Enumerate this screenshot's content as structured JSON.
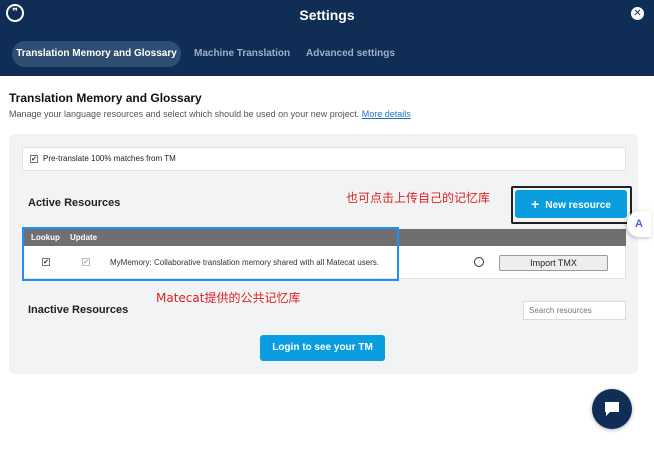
{
  "header": {
    "title": "Settings",
    "logo_glyph": "❞",
    "close_glyph": "✕",
    "tabs": [
      {
        "label": "Translation Memory and Glossary",
        "active": true
      },
      {
        "label": "Machine Translation",
        "active": false
      },
      {
        "label": "Advanced settings",
        "active": false
      }
    ]
  },
  "section": {
    "title": "Translation Memory and Glossary",
    "description": "Manage your language resources and select which should be used on your new project.",
    "link": "More details"
  },
  "pretranslate": {
    "label": "Pre-translate 100% matches from TM",
    "checked": true
  },
  "active_resources": {
    "title": "Active Resources",
    "new_button": "New resource",
    "new_button_icon": "plus-icon",
    "columns": [
      "Lookup",
      "Update"
    ],
    "rows": [
      {
        "lookup": true,
        "update": true,
        "name": "MyMemory: Collaborative translation memory shared with all Matecat users.",
        "icon": "globe-icon",
        "action": "Import TMX"
      }
    ]
  },
  "inactive_resources": {
    "title": "Inactive Resources",
    "search_placeholder": "Search resources"
  },
  "login_button": "Login to see your TM",
  "annotations": {
    "new_resource_note": "也可点击上传自己的记忆库",
    "public_tm_note": "Matecat提供的公共记忆库"
  },
  "colors": {
    "header_bg": "#0f2d55",
    "accent": "#0a9ee0",
    "annotation_red": "#e02020",
    "highlight_blue": "#1f8fff"
  }
}
